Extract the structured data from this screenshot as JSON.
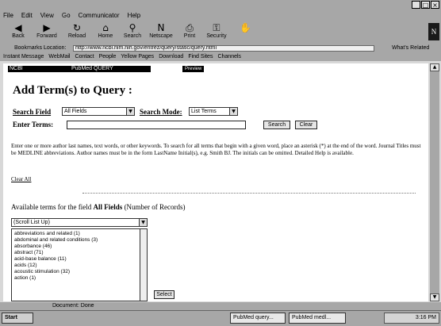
{
  "window": {
    "title": ""
  },
  "menu": [
    "File",
    "Edit",
    "View",
    "Go",
    "Communicator",
    "Help"
  ],
  "toolbar": {
    "buttons": [
      {
        "label": "Back",
        "icon": "back-arrow-icon",
        "glyph": "◀"
      },
      {
        "label": "Forward",
        "icon": "forward-arrow-icon",
        "glyph": "▶"
      },
      {
        "label": "Reload",
        "icon": "reload-icon",
        "glyph": "↻"
      },
      {
        "label": "Home",
        "icon": "home-icon",
        "glyph": "⌂"
      },
      {
        "label": "Search",
        "icon": "search-icon",
        "glyph": "⚲"
      },
      {
        "label": "Netscape",
        "icon": "netscape-icon",
        "glyph": "N"
      },
      {
        "label": "Print",
        "icon": "print-icon",
        "glyph": "⎙"
      },
      {
        "label": "Security",
        "icon": "lock-icon",
        "glyph": "🔒"
      },
      {
        "label": "",
        "icon": "stop-icon",
        "glyph": "✋"
      }
    ]
  },
  "location": {
    "bookmarks_label": "Bookmarks",
    "location_label": "Location:",
    "url": "http://www.ncbi.nlm.nih.gov/entrez/query/static/query.html",
    "whats_related": "What's Related"
  },
  "links": [
    "Instant Message",
    "WebMail",
    "Contact",
    "People",
    "Yellow Pages",
    "Download",
    "Find Sites",
    "Channels"
  ],
  "page": {
    "banner_left": "NCBI",
    "banner_right": "PubMed QUERY",
    "help": "Preview",
    "title": "Add Term(s) to Query :",
    "search_field_label": "Search Field",
    "search_field_value": "All Fields",
    "search_mode_label": "Search Mode:",
    "search_mode_value": "List Terms",
    "enter_terms_label": "Enter Terms:",
    "enter_terms_value": "",
    "search_button": "Search",
    "clear_button": "Clear",
    "instructions": "Enter one or more author last names, text words, or other keywords. To search for all terms that begin with a given word, place an asterisk (*) at the end of the word. Journal Titles must be MEDLINE abbreviations. Author names must be in the form LastName Initial(s), e.g. Smith BJ. The initials can be omitted. Detailed Help is available.",
    "clear_all": "Clear All",
    "available_prefix": "Available terms for the field ",
    "available_field": "All Fields",
    "available_suffix": " (Number of Records)",
    "scroll_select": "(Scroll List Up)",
    "terms": [
      "abbreviations and related (1)",
      "abdominal and related conditions (3)",
      "absorbance (46)",
      "abstract (71)",
      "acid-base balance (11)",
      "acids (12)",
      "acoustic stimulation (32)",
      "action (1)"
    ],
    "select_button": "Select"
  },
  "status": {
    "text": "Document: Done"
  },
  "taskbar": {
    "start": "Start",
    "tasks": [
      "PubMed query...",
      "PubMed medl..."
    ],
    "clock": "3:16 PM"
  }
}
